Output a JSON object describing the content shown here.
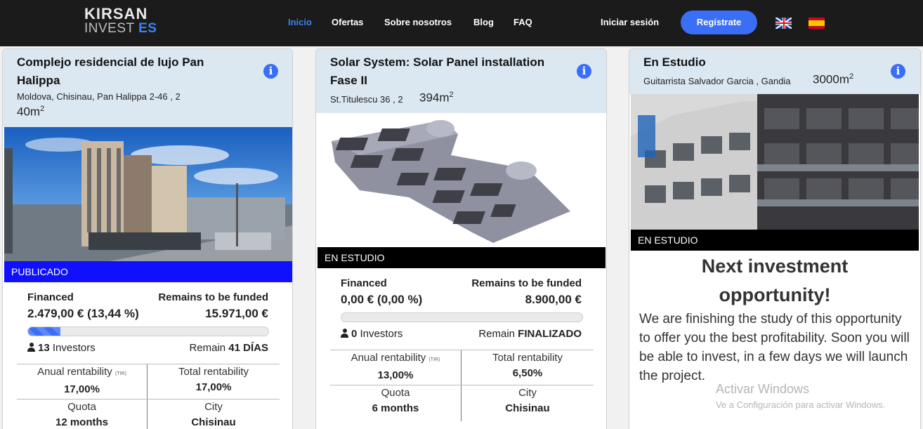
{
  "header": {
    "logo_top": "KIRSAN",
    "logo_invest": "INVEST",
    "logo_es": "ES",
    "nav": [
      "Inicio",
      "Ofertas",
      "Sobre nosotros",
      "Blog",
      "FAQ"
    ],
    "login": "Iniciar sesión",
    "register": "Regístrate",
    "accent_color": "#3b6ef6"
  },
  "cards": [
    {
      "title": "Complejo residencial de lujo Pan Halippa",
      "address": "Moldova, Chisinau, Pan Halippa 2-46 , 2",
      "area_value": "40m",
      "area_unit_sup": "2",
      "status": "PUBLICADO",
      "status_color": "#1010ff",
      "financed_label": "Financed",
      "financed_value": "2.479,00 € (13,44 %)",
      "remains_label": "Remains to be funded",
      "remains_value": "15.971,00 €",
      "progress_percent": 13.44,
      "investors_count": "13",
      "investors_label": "Investors",
      "remain_label": "Remain",
      "remain_value": "41 DÍAS",
      "anual_label": "Anual rentability",
      "anual_tir": "(TIR)",
      "anual_value": "17,00%",
      "total_label": "Total rentability",
      "total_value": "17,00%",
      "quota_label": "Quota",
      "quota_value": "12 months",
      "city_label": "City",
      "city_value": "Chisinau"
    },
    {
      "title": "Solar System: Solar Panel installation Fase II",
      "address": "St.Titulescu 36 , 2",
      "area_value": "394m",
      "area_unit_sup": "2",
      "status": "EN ESTUDIO",
      "status_color": "#000000",
      "financed_label": "Financed",
      "financed_value": "0,00 € (0,00 %)",
      "remains_label": "Remains to be funded",
      "remains_value": "8.900,00 €",
      "progress_percent": 0,
      "investors_count": "0",
      "investors_label": "Investors",
      "remain_label": "Remain",
      "remain_value": "FINALIZADO",
      "anual_label": "Anual rentability",
      "anual_tir": "(TIR)",
      "anual_value": "13,00%",
      "total_label": "Total rentability",
      "total_value": "6,50%",
      "quota_label": "Quota",
      "quota_value": "6 months",
      "city_label": "City",
      "city_value": "Chisinau"
    },
    {
      "title": "En Estudio",
      "address": "Guitarrista Salvador Garcia , Gandia",
      "area_value": "3000m",
      "area_unit_sup": "2",
      "status": "EN ESTUDIO",
      "status_color": "#000000",
      "next_title_1": "Next investment",
      "next_title_2": "opportunity!",
      "next_text": "We are finishing the study of this opportunity to offer you the best profitability. Soon you will be able to invest, in a few days we will launch the project."
    }
  ],
  "watermark": {
    "line1": "Activar Windows",
    "line2": "Ve a Configuración para activar Windows."
  }
}
